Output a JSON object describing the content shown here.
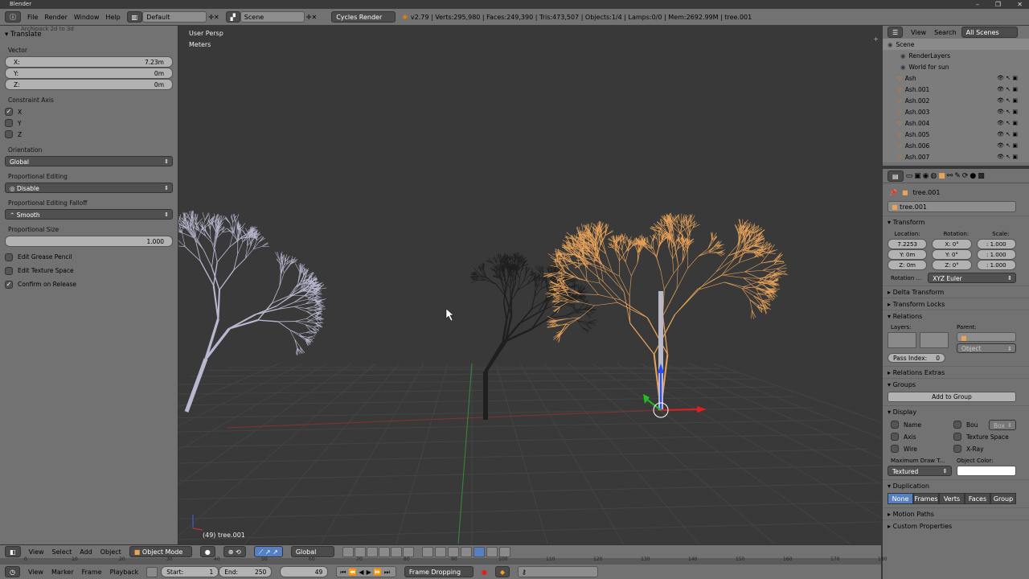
{
  "window": {
    "title": "Blender",
    "minimize": "–",
    "maximize": "❐",
    "close": "✕"
  },
  "info": {
    "menus": [
      "File",
      "Render",
      "Window",
      "Help"
    ],
    "layout": "Default",
    "scene": "Scene",
    "engine": "Cycles Render",
    "stats": "v2.79 | Verts:295,980 | Faces:249,390 | Tris:473,507 | Objects:1/4 | Lamps:0/0 | Mem:2692.99M | tree.001"
  },
  "toolshelf": {
    "collapsed_panel": "Archipack 2d to 3d",
    "title": "Translate",
    "vector_label": "Vector",
    "x": {
      "label": "X:",
      "value": "7.23m"
    },
    "y": {
      "label": "Y:",
      "value": "0m"
    },
    "z": {
      "label": "Z:",
      "value": "0m"
    },
    "constraint_label": "Constraint Axis",
    "axes": [
      {
        "label": "X",
        "checked": true
      },
      {
        "label": "Y",
        "checked": false
      },
      {
        "label": "Z",
        "checked": false
      }
    ],
    "orientation_label": "Orientation",
    "orientation": "Global",
    "prop_edit_label": "Proportional Editing",
    "prop_edit": "Disable",
    "falloff_label": "Proportional Editing Falloff",
    "falloff": "Smooth",
    "prop_size_label": "Proportional Size",
    "prop_size": "1.000",
    "options": [
      {
        "label": "Edit Grease Pencil",
        "checked": false
      },
      {
        "label": "Edit Texture Space",
        "checked": false
      },
      {
        "label": "Confirm on Release",
        "checked": true
      }
    ]
  },
  "viewport": {
    "view_name": "User Persp",
    "units": "Meters",
    "object_info": "(49) tree.001",
    "selected_color": "#e8a25a"
  },
  "outliner": {
    "menus": [
      "View",
      "Search"
    ],
    "display": "All Scenes",
    "items": [
      "Scene",
      "RenderLayers",
      "World for sun",
      "Ash",
      "Ash.001",
      "Ash.002",
      "Ash.003",
      "Ash.004",
      "Ash.005",
      "Ash.006",
      "Ash.007"
    ]
  },
  "properties": {
    "breadcrumb": "tree.001",
    "object_name": "tree.001",
    "transform": {
      "title": "Transform",
      "location_label": "Location:",
      "rotation_label": "Rotation:",
      "scale_label": "Scale:",
      "location": [
        "7.2253",
        "Y:   0m",
        "Z:   0m"
      ],
      "rotation": [
        "X:    0°",
        "Y:    0°",
        "Z:    0°"
      ],
      "scale": [
        ": 1.000",
        ": 1.000",
        ": 1.000"
      ],
      "rotation_mode_label": "Rotation ...",
      "rotation_mode": "XYZ Euler"
    },
    "delta": "Delta Transform",
    "locks": "Transform Locks",
    "relations": {
      "title": "Relations",
      "layers_label": "Layers:",
      "parent_label": "Parent:",
      "parent_type": "Object",
      "pass_index": "Pass Index:",
      "pass_value": "0"
    },
    "relations_extras": "Relations Extras",
    "groups": {
      "title": "Groups",
      "add": "Add to Group"
    },
    "display": {
      "title": "Display",
      "options": [
        "Name",
        "Axis",
        "Wire",
        "Bou",
        "Texture Space",
        "X-Ray"
      ],
      "bounds_type": "Box",
      "max_draw_label": "Maximum Draw T...",
      "max_draw": "Textured",
      "color_label": "Object Color:",
      "object_color": "#ffffff"
    },
    "duplication": {
      "title": "Duplication",
      "options": [
        "None",
        "Frames",
        "Verts",
        "Faces",
        "Group"
      ],
      "active": "None"
    },
    "motion_paths": "Motion Paths",
    "custom_props": "Custom Properties"
  },
  "v3d_header": {
    "menus": [
      "View",
      "Select",
      "Add",
      "Object"
    ],
    "mode": "Object Mode",
    "orientation": "Global"
  },
  "timeline": {
    "ruler": [
      "0",
      "10",
      "20",
      "30",
      "40",
      "50",
      "60",
      "70",
      "80",
      "90",
      "100",
      "110",
      "120",
      "130",
      "140",
      "150",
      "160",
      "170",
      "180"
    ],
    "menus": [
      "View",
      "Marker",
      "Frame",
      "Playback"
    ],
    "start_label": "Start:",
    "start": "1",
    "end_label": "End:",
    "end": "250",
    "current": "49",
    "sync": "Frame Dropping"
  }
}
